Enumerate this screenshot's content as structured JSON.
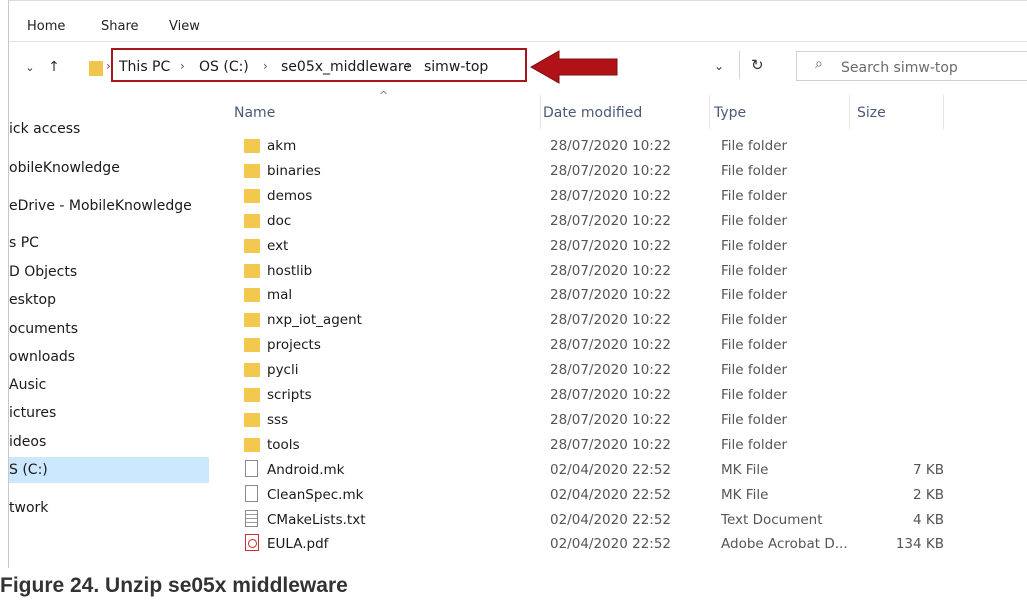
{
  "ribbon": {
    "tabs": [
      "Home",
      "Share",
      "View"
    ]
  },
  "address": {
    "crumbs": [
      "This PC",
      "OS (C:)",
      "se05x_middleware",
      "simw-top"
    ]
  },
  "search": {
    "placeholder": "Search simw-top"
  },
  "sidebar": {
    "items": [
      {
        "label": "ick access"
      },
      {
        "label": "obileKnowledge"
      },
      {
        "label": "eDrive - MobileKnowledge"
      },
      {
        "label": "s PC"
      },
      {
        "label": "D Objects"
      },
      {
        "label": "esktop"
      },
      {
        "label": "ocuments"
      },
      {
        "label": "ownloads"
      },
      {
        "label": "Ausic"
      },
      {
        "label": "ictures"
      },
      {
        "label": "ideos"
      },
      {
        "label": "S (C:)"
      },
      {
        "label": "twork"
      }
    ],
    "selected_index": 11
  },
  "columns": {
    "name": "Name",
    "date": "Date modified",
    "type": "Type",
    "size": "Size"
  },
  "files": [
    {
      "name": "akm",
      "date": "28/07/2020 10:22",
      "type": "File folder",
      "size": "",
      "icon": "folder-icon"
    },
    {
      "name": "binaries",
      "date": "28/07/2020 10:22",
      "type": "File folder",
      "size": "",
      "icon": "folder-icon"
    },
    {
      "name": "demos",
      "date": "28/07/2020 10:22",
      "type": "File folder",
      "size": "",
      "icon": "folder-icon"
    },
    {
      "name": "doc",
      "date": "28/07/2020 10:22",
      "type": "File folder",
      "size": "",
      "icon": "folder-icon"
    },
    {
      "name": "ext",
      "date": "28/07/2020 10:22",
      "type": "File folder",
      "size": "",
      "icon": "folder-icon"
    },
    {
      "name": "hostlib",
      "date": "28/07/2020 10:22",
      "type": "File folder",
      "size": "",
      "icon": "folder-icon"
    },
    {
      "name": "mal",
      "date": "28/07/2020 10:22",
      "type": "File folder",
      "size": "",
      "icon": "folder-icon"
    },
    {
      "name": "nxp_iot_agent",
      "date": "28/07/2020 10:22",
      "type": "File folder",
      "size": "",
      "icon": "folder-icon"
    },
    {
      "name": "projects",
      "date": "28/07/2020 10:22",
      "type": "File folder",
      "size": "",
      "icon": "folder-icon"
    },
    {
      "name": "pycli",
      "date": "28/07/2020 10:22",
      "type": "File folder",
      "size": "",
      "icon": "folder-icon"
    },
    {
      "name": "scripts",
      "date": "28/07/2020 10:22",
      "type": "File folder",
      "size": "",
      "icon": "folder-icon"
    },
    {
      "name": "sss",
      "date": "28/07/2020 10:22",
      "type": "File folder",
      "size": "",
      "icon": "folder-icon"
    },
    {
      "name": "tools",
      "date": "28/07/2020 10:22",
      "type": "File folder",
      "size": "",
      "icon": "folder-icon"
    },
    {
      "name": "Android.mk",
      "date": "02/04/2020 22:52",
      "type": "MK File",
      "size": "7 KB",
      "icon": "file-icon"
    },
    {
      "name": "CleanSpec.mk",
      "date": "02/04/2020 22:52",
      "type": "MK File",
      "size": "2 KB",
      "icon": "file-icon"
    },
    {
      "name": "CMakeLists.txt",
      "date": "02/04/2020 22:52",
      "type": "Text Document",
      "size": "4 KB",
      "icon": "text-file-icon"
    },
    {
      "name": "EULA.pdf",
      "date": "02/04/2020 22:52",
      "type": "Adobe Acrobat D...",
      "size": "134 KB",
      "icon": "pdf-icon"
    }
  ],
  "caption": "Figure 24.   Unzip se05x middleware",
  "colors": {
    "highlight_box": "#a4161a",
    "arrow": "#b01218",
    "folder": "#f3c84f",
    "selection": "#cce8ff"
  }
}
